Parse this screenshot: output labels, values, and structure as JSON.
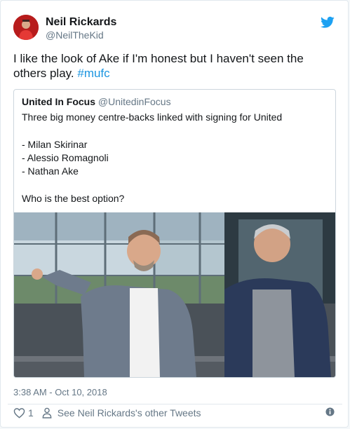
{
  "tweet": {
    "author_name": "Neil Rickards",
    "author_handle": "@NeilTheKid",
    "text_main": "I like the look of Ake if I'm honest but I haven't seen the others play.",
    "hashtag": "#mufc",
    "timestamp": "3:38 AM - Oct 10, 2018",
    "like_count": "1",
    "other_tweets_link": "See Neil Rickards's other Tweets"
  },
  "quoted_tweet": {
    "author_name": "United In Focus",
    "author_handle": "@UnitedinFocus",
    "lines": [
      "Three big money centre-backs linked with signing for United",
      "- Milan Skirinar",
      "- Alessio Romagnoli",
      "- Nathan Ake",
      "Who is the best option?"
    ]
  },
  "icons": {
    "brand": "twitter-bird-icon",
    "like": "heart-icon",
    "profile": "person-icon",
    "info": "info-icon"
  },
  "colors": {
    "brand": "#1da1f2",
    "hashtag": "#1b95e0",
    "text": "#14171a",
    "secondary": "#657786",
    "border": "#e1e8ed"
  }
}
